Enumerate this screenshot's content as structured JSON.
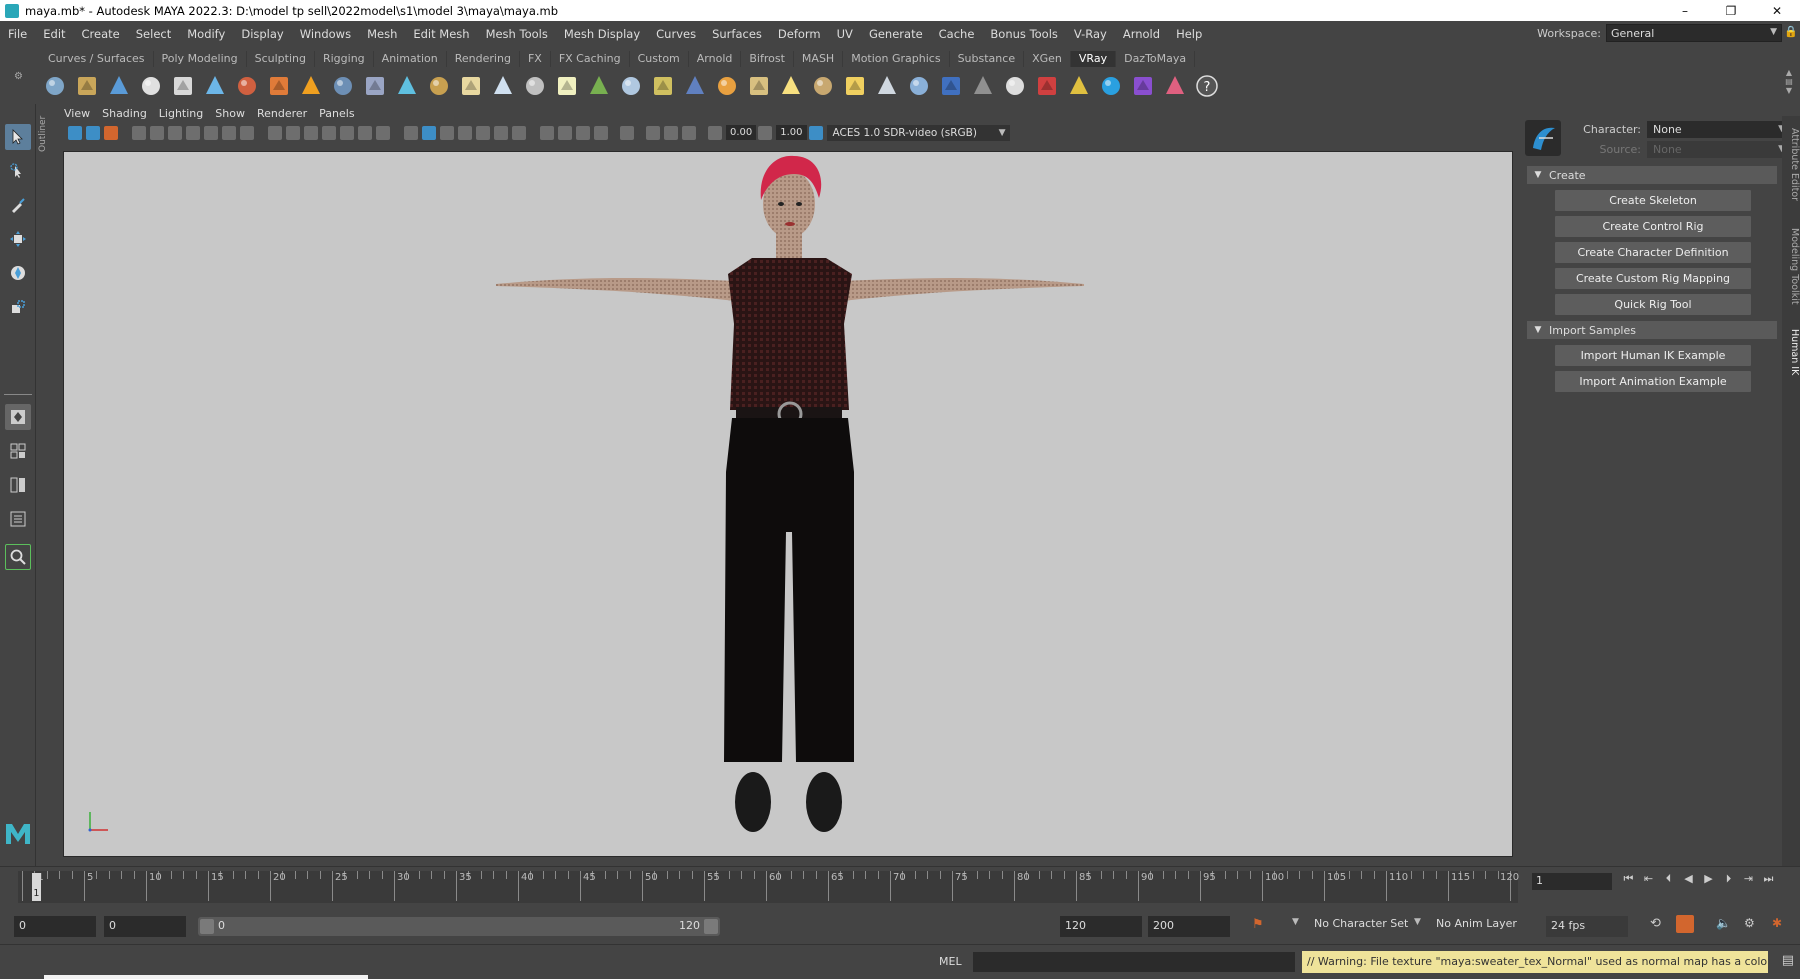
{
  "window": {
    "title": "maya.mb* - Autodesk MAYA 2022.3: D:\\model tp sell\\2022model\\s1\\model 3\\maya\\maya.mb",
    "minimize": "–",
    "maximize": "❐",
    "close": "✕"
  },
  "menubar": [
    "File",
    "Edit",
    "Create",
    "Select",
    "Modify",
    "Display",
    "Windows",
    "Mesh",
    "Edit Mesh",
    "Mesh Tools",
    "Mesh Display",
    "Curves",
    "Surfaces",
    "Deform",
    "UV",
    "Generate",
    "Cache",
    "Bonus Tools",
    "V-Ray",
    "Arnold",
    "Help"
  ],
  "workspace": {
    "label": "Workspace:",
    "value": "General"
  },
  "shelf_tabs": [
    "Curves / Surfaces",
    "Poly Modeling",
    "Sculpting",
    "Rigging",
    "Animation",
    "Rendering",
    "FX",
    "FX Caching",
    "Custom",
    "Arnold",
    "Bifrost",
    "MASH",
    "Motion Graphics",
    "Substance",
    "XGen",
    "VRay",
    "DazToMaya"
  ],
  "shelf_active_tab": "VRay",
  "shelf_icons": [
    "vray-render-icon",
    "vray-ipr-icon",
    "vray-frame-buffer-icon",
    "vray-light-icon",
    "vray-settings-icon",
    "vray-sphere-light-icon",
    "vray-material-icon",
    "vray-mtl-icon",
    "vray-fire-icon",
    "vray-volume-icon",
    "vray-proxy-icon",
    "vray-mesh-light-icon",
    "vray-scatter-icon",
    "vray-environment-icon",
    "vray-dome-icon",
    "vray-clipper-icon",
    "vray-sun-icon",
    "vray-grass-icon",
    "vray-fur-icon",
    "vray-hair-icon",
    "vray-sphere-icon",
    "vray-dome-light-icon",
    "vray-rect-light-icon",
    "vray-ies-light-icon",
    "vray-omni-icon",
    "vray-cone-icon",
    "vray-sunlight-icon",
    "vray-plane-icon",
    "vray-ball-icon",
    "vray-blend-icon",
    "vray-checker-icon",
    "vray-vfb-icon",
    "vray-info-icon",
    "vray-cloud-icon",
    "vray-chaos-icon",
    "vray-colors-icon",
    "help-icon"
  ],
  "viewport": {
    "panel_menu": [
      "View",
      "Shading",
      "Lighting",
      "Show",
      "Renderer",
      "Panels"
    ],
    "exposure": "0.00",
    "gamma": "1.00",
    "color_management": "ACES 1.0 SDR-video (sRGB)",
    "outliner_label": "Outliner"
  },
  "human_ik": {
    "character_label": "Character:",
    "character_value": "None",
    "source_label": "Source:",
    "source_value": "None",
    "create_section": "Create",
    "create_buttons": [
      "Create Skeleton",
      "Create Control Rig",
      "Create Character Definition",
      "Create Custom Rig Mapping",
      "Quick Rig Tool"
    ],
    "import_section": "Import Samples",
    "import_buttons": [
      "Import Human IK Example",
      "Import Animation Example"
    ]
  },
  "side_tabs": [
    "Attribute Editor",
    "Modeling Toolkit",
    "Human IK"
  ],
  "timeline": {
    "ticks": [
      1,
      5,
      10,
      15,
      20,
      25,
      30,
      35,
      40,
      45,
      50,
      55,
      60,
      65,
      70,
      75,
      80,
      85,
      90,
      95,
      100,
      105,
      110,
      115,
      120
    ],
    "current_frame": "1",
    "current_frame_field": "1"
  },
  "range": {
    "start": "0",
    "anim_start": "0",
    "range_start": "0",
    "range_end": "120",
    "end": "120",
    "anim_end": "200",
    "character_set": "No Character Set",
    "anim_layer": "No Anim Layer",
    "fps": "24 fps"
  },
  "command_line": {
    "mode": "MEL",
    "warning": "// Warning: File texture \"maya:sweater_tex_Normal\" used as normal map has a color correction e"
  },
  "colors": {
    "ui_bg": "#444444",
    "viewport_bg": "#c8c8c8",
    "selected_tool": "#5d7f9c",
    "warning_bg": "#efe39a",
    "accent_blue": "#3d8ec6"
  }
}
